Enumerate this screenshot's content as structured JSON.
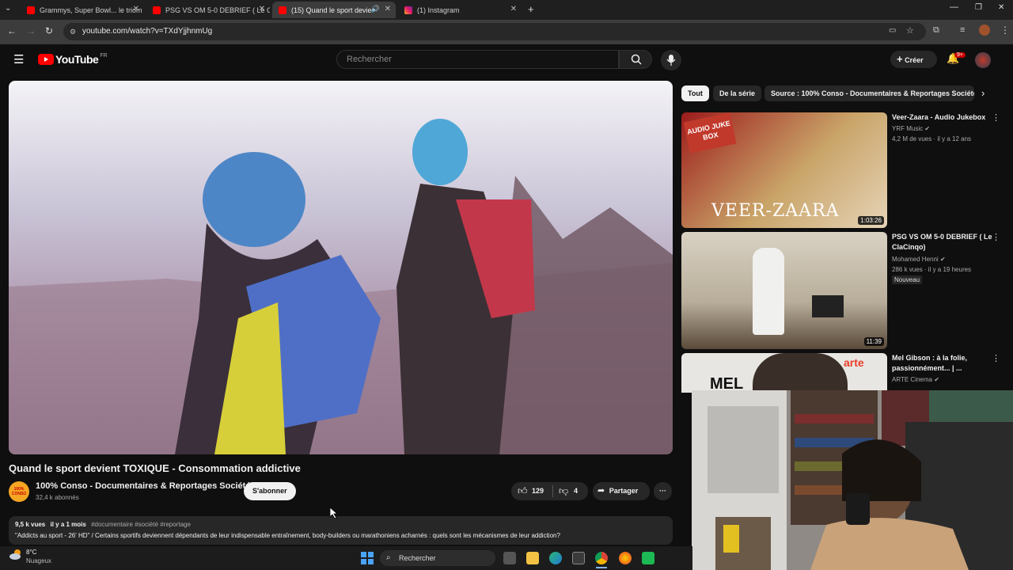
{
  "browser": {
    "tabs": [
      {
        "title": "Grammys, Super Bowl... le triom",
        "active": false
      },
      {
        "title": "PSG VS OM 5-0 DEBRIEF ( Le Cl",
        "active": false
      },
      {
        "title": "(15) Quand le sport devient",
        "active": true
      },
      {
        "title": "(1) Instagram",
        "active": false
      }
    ],
    "new_tab": "+",
    "url": "youtube.com/watch?v=TXdYjjhnmUg"
  },
  "youtube": {
    "logo_text": "YouTube",
    "region": "FR",
    "search_placeholder": "Rechercher",
    "create_label": "Créer",
    "notif_count": "9+"
  },
  "video": {
    "title": "Quand le sport devient TOXIQUE - Consommation addictive",
    "channel": "100% Conso - Documentaires & Reportages Société",
    "channel_avatar_text": "100% CONSO",
    "subscribers": "32,4 k abonnés",
    "subscribe_label": "S'abonner",
    "likes": "129",
    "dislikes": "4",
    "share_label": "Partager",
    "views": "9,5 k vues",
    "age": "il y a 1 mois",
    "tags": "#documentaire #société #reportage",
    "description": "\"Addicts au sport - 26' HD\" / Certains sportifs deviennent dépendants de leur indispensable entraînement, body-builders ou marathoniens acharnés : quels sont les mécanismes de leur addiction?"
  },
  "chips": [
    "Tout",
    "De la série",
    "Source : 100% Conso - Documentaires & Reportages Société"
  ],
  "recommendations": [
    {
      "title": "Veer-Zaara - Audio Jukebox",
      "channel": "YRF Music",
      "meta": "4,2 M de vues · il y a 12 ans",
      "duration": "1:03:26",
      "badge": "",
      "thumb_text": "VEER-ZAARA",
      "thumb_text2": "AUDIO JUKE BOX"
    },
    {
      "title": "PSG VS OM 5-0 DEBRIEF ( Le ClaCinqo)",
      "channel": "Mohamed Henni",
      "meta": "286 k vues · il y a 19 heures",
      "duration": "11:39",
      "badge": "Nouveau",
      "thumb_text": "",
      "thumb_text2": ""
    },
    {
      "title": "Mel Gibson : à la folie, passionnément... | ...",
      "channel": "ARTE Cinema",
      "meta": "",
      "duration": "",
      "badge": "",
      "thumb_text": "MEL",
      "thumb_text2": "arte"
    }
  ],
  "taskbar": {
    "temp": "8°C",
    "weather": "Nuageux",
    "search_label": "Rechercher"
  },
  "colors": {
    "yt_red": "#ff0000",
    "bg": "#0f0f0f",
    "chip_bg": "#272727"
  }
}
